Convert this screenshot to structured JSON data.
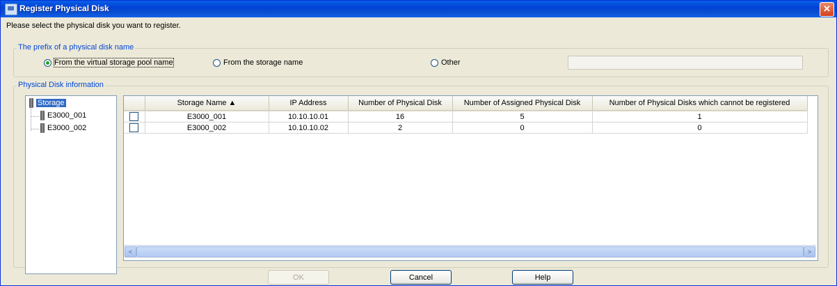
{
  "window": {
    "title": "Register Physical Disk",
    "close_symbol": "✕"
  },
  "instruction": "Please select the physical disk you want to register.",
  "prefix_group": {
    "legend": "The prefix of a physical disk name",
    "options": [
      {
        "label": "From the virtual storage pool name",
        "selected": true
      },
      {
        "label": "From the storage name",
        "selected": false
      },
      {
        "label": "Other",
        "selected": false
      }
    ],
    "other_value": ""
  },
  "disk_info_group": {
    "legend": "Physical Disk information"
  },
  "tree": {
    "root": "Storage",
    "children": [
      "E3000_001",
      "E3000_002"
    ]
  },
  "table": {
    "columns": [
      "Storage Name ▲",
      "IP Address",
      "Number of Physical Disk",
      "Number of Assigned Physical Disk",
      "Number of Physical Disks which cannot be registered"
    ],
    "rows": [
      [
        "E3000_001",
        "10.10.10.01",
        "16",
        "5",
        "1"
      ],
      [
        "E3000_002",
        "10.10.10.02",
        "2",
        "0",
        "0"
      ]
    ]
  },
  "scrollbar": {
    "left": "<",
    "right": ">"
  },
  "buttons": {
    "ok": "OK",
    "cancel": "Cancel",
    "help": "Help"
  },
  "colors": {
    "titlebar": "#0a4fd0",
    "legend": "#0046d5",
    "selection": "#316ac5"
  }
}
